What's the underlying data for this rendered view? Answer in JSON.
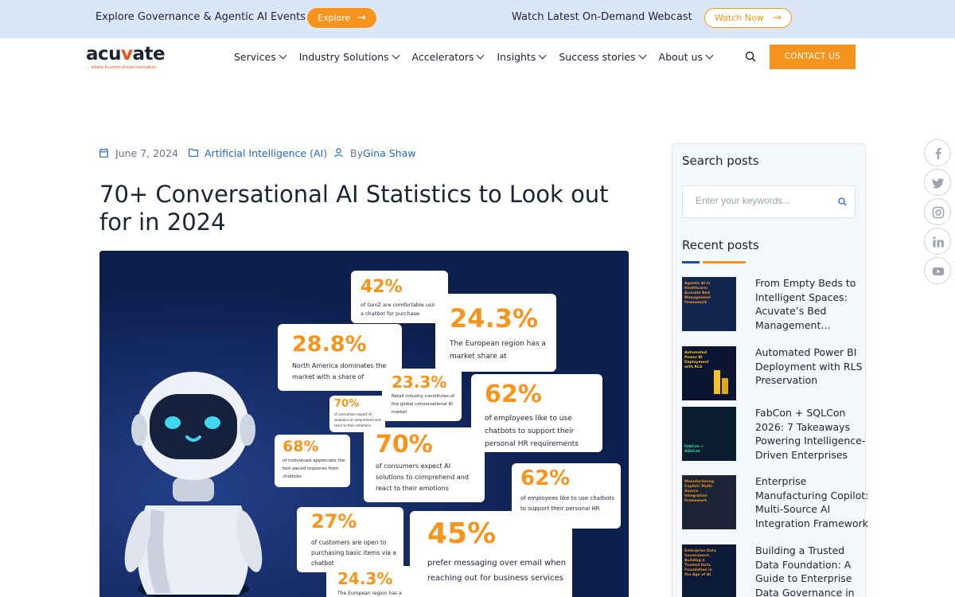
{
  "topbar": {
    "events_text": "Explore Governance & Agentic AI Events",
    "explore_label": "Explore",
    "webcast_text": "Watch Latest On-Demand Webcast",
    "watch_label": "Watch Now",
    "accent": "#f7941d",
    "background": "#dbe7f7"
  },
  "header": {
    "logo_word_a": "acu",
    "logo_word_v": "v",
    "logo_word_b": "ate",
    "logo_tagline": "... where Acumen drives Innovation",
    "nav": [
      {
        "label": "Services"
      },
      {
        "label": "Industry Solutions"
      },
      {
        "label": "Accelerators"
      },
      {
        "label": "Insights"
      },
      {
        "label": "Success stories"
      },
      {
        "label": "About us"
      }
    ],
    "search_icon": "search-icon",
    "contact_label": "CONTACT US"
  },
  "article": {
    "date": "June 7, 2024",
    "category": "Artificial Intelligence (AI)",
    "by": "By",
    "author": "Gina Shaw",
    "title": "70+ Conversational AI Statistics to Look out for in 2024"
  },
  "hero": {
    "cards": [
      {
        "stat": "42%",
        "text": "of GenZ are comfortable using a chatbot for purchase."
      },
      {
        "stat": "24.3%",
        "text": "The European region has a market share at"
      },
      {
        "stat": "28.8%",
        "text": "North America dominates the market with a share of"
      },
      {
        "stat": "23.3%",
        "text": "Retail industry constitutes of the global conversational AI market"
      },
      {
        "stat": "62%",
        "text": "of employees like to use chatbots to support their personal HR requirements"
      },
      {
        "stat": "70%",
        "text": "of consumers expect AI solutions to comprehend and react to their emotions"
      },
      {
        "stat": "68%",
        "text": "of individuals appreciate the fast-paced response from chatbots"
      },
      {
        "stat": "70%",
        "text": "of consumers expect AI solutions to comprehend and react to their emotions"
      },
      {
        "stat": "62%",
        "text": "of employees like to use chatbots to support their personal HR requirements"
      },
      {
        "stat": "27%",
        "text": "of customers are open to purchasing basic items via a chatbot"
      },
      {
        "stat": "45%",
        "text": "prefer messaging over email when reaching out for business services"
      },
      {
        "stat": "24.3%",
        "text": "The European region has a"
      }
    ]
  },
  "sidebar": {
    "search_heading": "Search posts",
    "search_placeholder": "Enter your keywords...",
    "recent_heading": "Recent posts",
    "posts": [
      {
        "title": "From Empty Beds to Intelligent Spaces: Acuvate’s Bed Management…",
        "thumb_text": "Agentic AI in Healthcare: Acuvate Bed Management Framework"
      },
      {
        "title": "Automated Power BI Deployment with RLS Preservation",
        "thumb_text": "Automated Power BI Deployment with RLS"
      },
      {
        "title": "FabCon + SQLCon 2026: 7 Takeaways Powering Intelligence-Driven Enterprises",
        "thumb_text": "FabCon + SQLCon"
      },
      {
        "title": "Enterprise Manufacturing Copilot: Multi-Source AI Integration Framework",
        "thumb_text": "Manufacturing Copilot: Multi-Source Integration Framework"
      },
      {
        "title": "Building a Trusted Data Foundation: A Guide to Enterprise Data Governance in the AI…",
        "thumb_text": "Enterprise Data Governance: Building a Trusted Data Foundation in the Age of AI"
      }
    ]
  },
  "social": [
    {
      "icon": "facebook-icon"
    },
    {
      "icon": "twitter-icon"
    },
    {
      "icon": "instagram-icon"
    },
    {
      "icon": "linkedin-icon"
    },
    {
      "icon": "youtube-icon"
    }
  ]
}
